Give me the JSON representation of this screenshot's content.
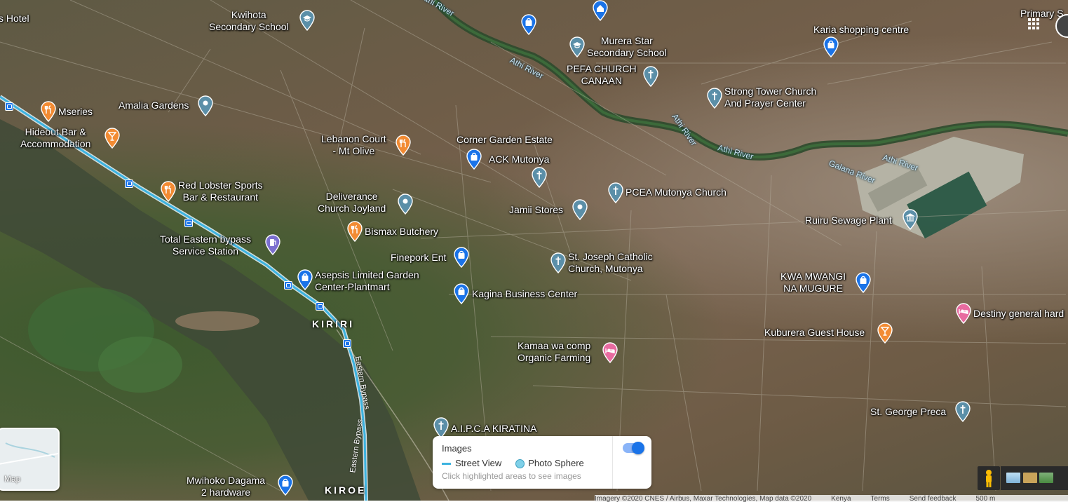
{
  "places": [
    {
      "name": "Hotel",
      "kind": "hotel",
      "text": "s Hotel"
    },
    {
      "name": "Kwihota Secondary School",
      "kind": "school",
      "lines": [
        "Kwihota",
        "Secondary School"
      ]
    },
    {
      "name": "Murera Star Secondary School",
      "kind": "school",
      "lines": [
        "Murera Star",
        "Secondary School"
      ]
    },
    {
      "name": "Karia shopping centre",
      "kind": "shop",
      "lines": [
        "Karia shopping centre"
      ]
    },
    {
      "name": "Primary",
      "kind": "school",
      "lines": [
        "Primary S"
      ]
    },
    {
      "name": "PEFA CHURCH CANAAN",
      "kind": "church",
      "lines": [
        "PEFA CHURCH",
        "CANAAN"
      ]
    },
    {
      "name": "Strong Tower Church And Prayer Center",
      "kind": "church",
      "lines": [
        "Strong Tower Church",
        "And Prayer Center"
      ]
    },
    {
      "name": "Mseries",
      "kind": "food",
      "lines": [
        "Mseries"
      ]
    },
    {
      "name": "Amalia Gardens",
      "kind": "place",
      "lines": [
        "Amalia Gardens"
      ]
    },
    {
      "name": "Hideout Bar & Accommodation",
      "kind": "bar",
      "lines": [
        "Hideout Bar &",
        "Accommodation"
      ]
    },
    {
      "name": "Lebanon Court - Mt Olive",
      "kind": "food",
      "lines": [
        "Lebanon Court",
        "- Mt Olive"
      ]
    },
    {
      "name": "Corner Garden Estate",
      "kind": "place",
      "lines": [
        "Corner Garden Estate"
      ]
    },
    {
      "name": "ACK Mutonya",
      "kind": "church",
      "lines": [
        "ACK Mutonya"
      ]
    },
    {
      "name": "Red Lobster Sports Bar & Restaurant",
      "kind": "food",
      "lines": [
        "Red Lobster Sports",
        "Bar & Restaurant"
      ]
    },
    {
      "name": "Deliverance Church Joyland",
      "kind": "place",
      "lines": [
        "Deliverance",
        "Church Joyland"
      ]
    },
    {
      "name": "PCEA Mutonya Church",
      "kind": "church",
      "lines": [
        "PCEA Mutonya Church"
      ]
    },
    {
      "name": "Jamii Stores",
      "kind": "place",
      "lines": [
        "Jamii Stores"
      ]
    },
    {
      "name": "Ruiru Sewage Plant",
      "kind": "gov",
      "lines": [
        "Ruiru Sewage Plant"
      ]
    },
    {
      "name": "Bismax Butchery",
      "kind": "food",
      "lines": [
        "Bismax Butchery"
      ]
    },
    {
      "name": "Total Eastern bypass Service Station",
      "kind": "fuel",
      "lines": [
        "Total Eastern bypass",
        "Service Station"
      ]
    },
    {
      "name": "Finepork Ent",
      "kind": "shop",
      "lines": [
        "Finepork Ent"
      ]
    },
    {
      "name": "St. Joseph Catholic Church, Mutonya",
      "kind": "church",
      "lines": [
        "St. Joseph Catholic",
        "Church, Mutonya"
      ]
    },
    {
      "name": "Asepsis Limited Garden Center-Plantmart",
      "kind": "shop",
      "lines": [
        "Asepsis Limited Garden",
        "Center-Plantmart"
      ]
    },
    {
      "name": "KWA MWANGI NA MUGURE",
      "kind": "shop",
      "lines": [
        "KWA MWANGI",
        "NA MUGURE"
      ]
    },
    {
      "name": "Kagina Business Center",
      "kind": "shop",
      "lines": [
        "Kagina Business Center"
      ]
    },
    {
      "name": "Destiny general hardware",
      "kind": "hotel",
      "lines": [
        "Destiny general hard"
      ]
    },
    {
      "name": "Kuburera Guest House",
      "kind": "bar",
      "lines": [
        "Kuburera Guest House"
      ]
    },
    {
      "name": "Kamaa wa comp Organic Farming",
      "kind": "hotel",
      "lines": [
        "Kamaa wa comp",
        "Organic Farming"
      ]
    },
    {
      "name": "St. George Preca",
      "kind": "church",
      "lines": [
        "St. George Preca"
      ]
    },
    {
      "name": "A.I.P.C.A KIRATINA",
      "kind": "church",
      "lines": [
        "A.I.P.C.A KIRATINA"
      ]
    },
    {
      "name": "Mwihoko Dagama 2 hardware",
      "kind": "shop",
      "lines": [
        "Mwihoko Dagama",
        "2 hardware"
      ]
    }
  ],
  "areas": {
    "kiriri": "KIRIRI",
    "kiroe": "KIROE"
  },
  "rivers": {
    "athi1": "Athi River",
    "athi2": "Athi River",
    "athi3": "Athi River",
    "galana": "Galana River",
    "athi4": "Athi River",
    "top": "Athi River"
  },
  "roads": {
    "bypass1": "Eastern Bypass",
    "bypass2": "Eastern Bypass"
  },
  "legend": {
    "title": "Images",
    "street_view": "Street View",
    "photo_sphere": "Photo Sphere",
    "hint": "Click highlighted areas to see images",
    "toggle_on": true,
    "street_view_color": "#3db3e0"
  },
  "minimap": {
    "label": "Map"
  },
  "attribution": {
    "imagery": "Imagery ©2020 CNES / Airbus, Maxar Technologies, Map data ©2020",
    "country": "Kenya",
    "terms": "Terms",
    "feedback": "Send feedback",
    "scale": "500 m"
  },
  "colors": {
    "food": "#f28b33",
    "bar": "#f28b33",
    "shop": "#1a73e8",
    "church": "#5b8fa8",
    "school": "#5b8fa8",
    "place": "#5b8fa8",
    "gov": "#5b8fa8",
    "fuel": "#7b6fcf",
    "hotel": "#e86ba0",
    "home": "#1a73e8",
    "street_view_line": "#3db3e0"
  }
}
